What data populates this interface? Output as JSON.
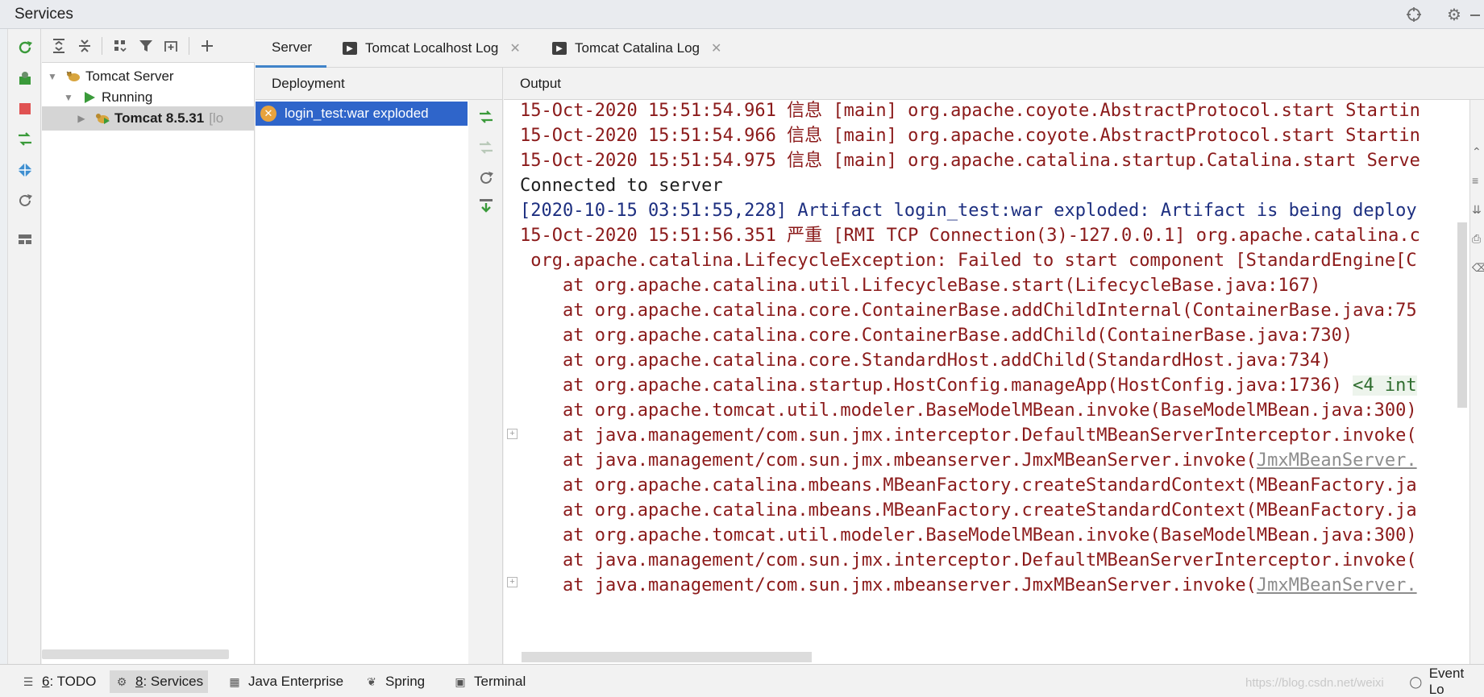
{
  "window": {
    "title": "Services"
  },
  "title_icons": [
    "crosshair-icon",
    "gear-icon",
    "minimize-icon"
  ],
  "left_toolbar": [
    "rerun-icon",
    "deploy-icon",
    "stop-icon",
    "redeploy-icon",
    "services-icon",
    "refresh-icon",
    "layout-icon"
  ],
  "tree_toolbar": [
    "expand-all-icon",
    "collapse-all-icon",
    "group-icon",
    "filter-icon",
    "new-tab-icon",
    "add-icon"
  ],
  "tree": {
    "root": "Tomcat Server",
    "status": "Running",
    "instance": "Tomcat 8.5.31",
    "instance_suffix": "[lo"
  },
  "tabs": [
    {
      "label": "Server"
    },
    {
      "label": "Tomcat Localhost Log"
    },
    {
      "label": "Tomcat Catalina Log"
    }
  ],
  "deployment": {
    "header": "Deployment",
    "item": "login_test:war exploded"
  },
  "output": {
    "header": "Output",
    "lines": [
      "15-Oct-2020 15:51:54.961 信息 [main] org.apache.coyote.AbstractProtocol.start Startin",
      "15-Oct-2020 15:51:54.966 信息 [main] org.apache.coyote.AbstractProtocol.start Startin",
      "15-Oct-2020 15:51:54.975 信息 [main] org.apache.catalina.startup.Catalina.start Serve",
      "Connected to server",
      "[2020-10-15 03:51:55,228] Artifact login_test:war exploded: Artifact is being deploy",
      "15-Oct-2020 15:51:56.351 严重 [RMI TCP Connection(3)-127.0.0.1] org.apache.catalina.c",
      " org.apache.catalina.LifecycleException: Failed to start component [StandardEngine[C",
      "    at org.apache.catalina.util.LifecycleBase.start(LifecycleBase.java:167)",
      "    at org.apache.catalina.core.ContainerBase.addChildInternal(ContainerBase.java:75",
      "    at org.apache.catalina.core.ContainerBase.addChild(ContainerBase.java:730)",
      "    at org.apache.catalina.core.StandardHost.addChild(StandardHost.java:734)",
      "    at org.apache.catalina.startup.HostConfig.manageApp(HostConfig.java:1736) ",
      "    at org.apache.tomcat.util.modeler.BaseModelMBean.invoke(BaseModelMBean.java:300)",
      "    at java.management/com.sun.jmx.interceptor.DefaultMBeanServerInterceptor.invoke(",
      "    at java.management/com.sun.jmx.mbeanserver.JmxMBeanServer.invoke(",
      "    at org.apache.catalina.mbeans.MBeanFactory.createStandardContext(MBeanFactory.ja",
      "    at org.apache.catalina.mbeans.MBeanFactory.createStandardContext(MBeanFactory.ja",
      "    at org.apache.tomcat.util.modeler.BaseModelMBean.invoke(BaseModelMBean.java:300)",
      "    at java.management/com.sun.jmx.interceptor.DefaultMBeanServerInterceptor.invoke(",
      "    at java.management/com.sun.jmx.mbeanserver.JmxMBeanServer.invoke("
    ],
    "folded_hint": "<4 int",
    "link_1": "JmxMBeanServer.",
    "link_2": "JmxMBeanServer."
  },
  "statusbar": {
    "todo_num": "6",
    "todo_label": ": TODO",
    "services_num": "8",
    "services_label": ": Services",
    "java_enterprise": "Java Enterprise",
    "spring": "Spring",
    "terminal": "Terminal",
    "event_log": "Event Lo",
    "watermark": "https://blog.csdn.net/weixi"
  },
  "colors": {
    "selection": "#2f65ca",
    "tab_underline": "#4083c9",
    "error_text": "#8b1a1a",
    "info_text": "#1d2f80",
    "run_green": "#3a9a3a",
    "stop_red": "#e05252"
  }
}
